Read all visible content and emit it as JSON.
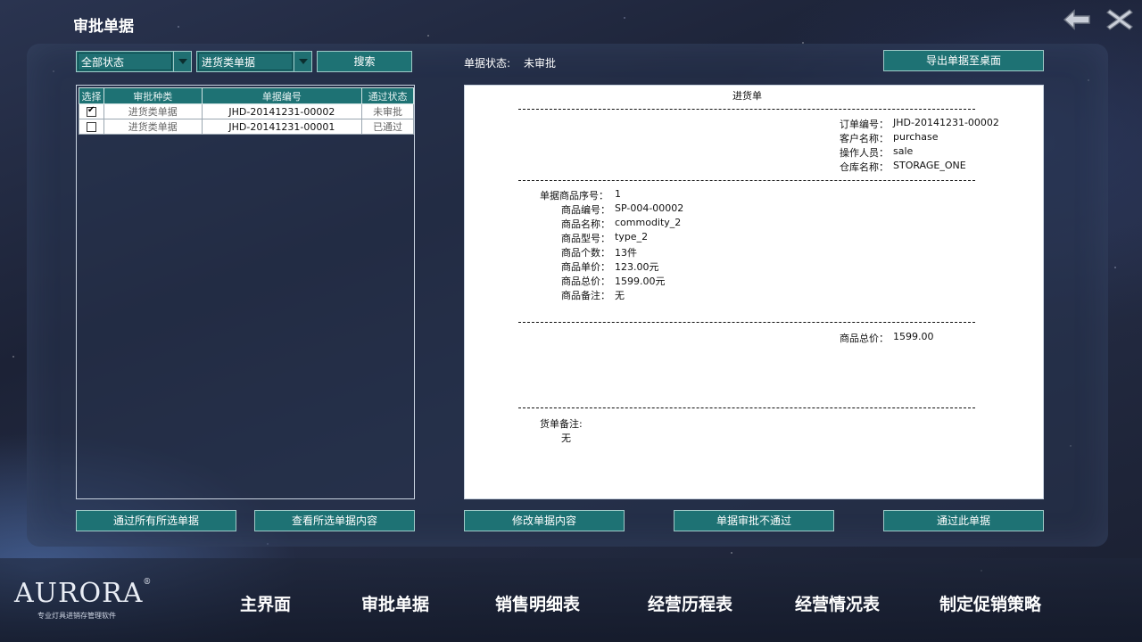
{
  "page_title": "审批单据",
  "filters": {
    "status_select": "全部状态",
    "type_select": "进货类单据",
    "search_button": "搜索"
  },
  "status": {
    "label": "单据状态:",
    "value": "未审批"
  },
  "export_button": "导出单据至桌面",
  "list": {
    "headers": [
      "选择",
      "审批种类",
      "单据编号",
      "通过状态"
    ],
    "rows": [
      {
        "checked": true,
        "type": "进货类单据",
        "id": "JHD-20141231-00002",
        "state": "未审批"
      },
      {
        "checked": false,
        "type": "进货类单据",
        "id": "JHD-20141231-00001",
        "state": "已通过"
      }
    ]
  },
  "document": {
    "title": "进货单",
    "header": [
      {
        "label": "订单编号：",
        "value": "JHD-20141231-00002"
      },
      {
        "label": "客户名称：",
        "value": "purchase"
      },
      {
        "label": "操作人员：",
        "value": "sale"
      },
      {
        "label": "仓库名称：",
        "value": "STORAGE_ONE"
      }
    ],
    "item": [
      {
        "label": "单据商品序号：",
        "value": "1"
      },
      {
        "label": "商品编号：",
        "value": "SP-004-00002"
      },
      {
        "label": "商品名称：",
        "value": "commodity_2"
      },
      {
        "label": "商品型号：",
        "value": "type_2"
      },
      {
        "label": "商品个数：",
        "value": "13件"
      },
      {
        "label": "商品单价：",
        "value": "123.00元"
      },
      {
        "label": "商品总价：",
        "value": "1599.00元"
      },
      {
        "label": "商品备注：",
        "value": "无"
      }
    ],
    "total": {
      "label": "商品总价：",
      "value": "1599.00"
    },
    "remark": {
      "label": "货单备注:",
      "value": "无"
    }
  },
  "actions": {
    "pass_all_selected": "通过所有所选单据",
    "view_selected": "查看所选单据内容",
    "modify": "修改单据内容",
    "reject": "单据审批不通过",
    "pass_this": "通过此单据"
  },
  "logo": {
    "brand": "AURORA",
    "registered": "®",
    "slogan": "专业灯具进销存管理软件"
  },
  "nav": [
    "主界面",
    "审批单据",
    "销售明细表",
    "经营历程表",
    "经营情况表",
    "制定促销策略"
  ],
  "colors": {
    "accent": "#1e7274",
    "border": "#9fc9c7"
  },
  "icons": {
    "back": "back-arrow-icon",
    "close": "close-icon"
  }
}
